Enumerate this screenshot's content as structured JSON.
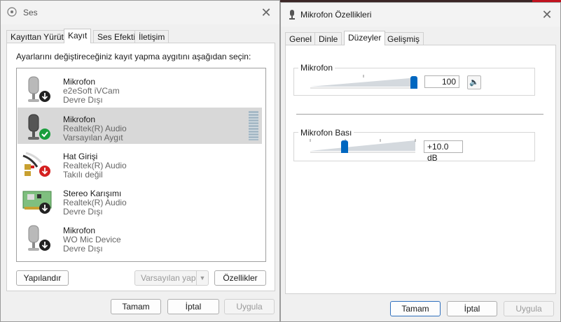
{
  "sound_window": {
    "title": "Ses",
    "tabs": [
      "Kayıttan Yürüt",
      "Kayıt",
      "Ses Efekti",
      "İletişim"
    ],
    "active_tab": "Kayıt",
    "instruction": "Ayarlarını değiştireceğiniz kayıt yapma aygıtını aşağıdan seçin:",
    "devices": [
      {
        "name": "Mikrofon",
        "driver": "e2eSoft iVCam",
        "status": "Devre Dışı",
        "icon": "microphone-icon",
        "badge": "down-arrow-icon"
      },
      {
        "name": "Mikrofon",
        "driver": "Realtek(R) Audio",
        "status": "Varsayılan Aygıt",
        "icon": "microphone-icon",
        "badge": "checkmark-icon",
        "selected": true
      },
      {
        "name": "Hat Girişi",
        "driver": "Realtek(R) Audio",
        "status": "Takılı değil",
        "icon": "audio-cable-icon",
        "badge": "red-down-arrow-icon"
      },
      {
        "name": "Stereo Karışımı",
        "driver": "Realtek(R) Audio",
        "status": "Devre Dışı",
        "icon": "circuit-board-icon",
        "badge": "down-arrow-icon"
      },
      {
        "name": "Mikrofon",
        "driver": "WO Mic Device",
        "status": "Devre Dışı",
        "icon": "microphone-icon",
        "badge": "down-arrow-icon"
      }
    ],
    "configure_label": "Yapılandır",
    "set_default_label": "Varsayılan yap",
    "properties_label": "Özellikler",
    "ok_label": "Tamam",
    "cancel_label": "İptal",
    "apply_label": "Uygula"
  },
  "mic_props_window": {
    "title": "Mikrofon Özellikleri",
    "tabs": [
      "Genel",
      "Dinle",
      "Düzeyler",
      "Gelişmiş"
    ],
    "active_tab": "Düzeyler",
    "mic_group_label": "Mikrofon",
    "mic_level": 100,
    "mic_value_text": "100",
    "boost_group_label": "Mikrofon Bası",
    "boost_value_text": "+10.0 dB",
    "boost_level_fraction": 0.33,
    "ok_label": "Tamam",
    "cancel_label": "İptal",
    "apply_label": "Uygula"
  },
  "colors": {
    "accent": "#0067c0",
    "selected_row": "#d8d8d8",
    "success_green": "#1a9e3c",
    "error_red": "#d42020"
  }
}
